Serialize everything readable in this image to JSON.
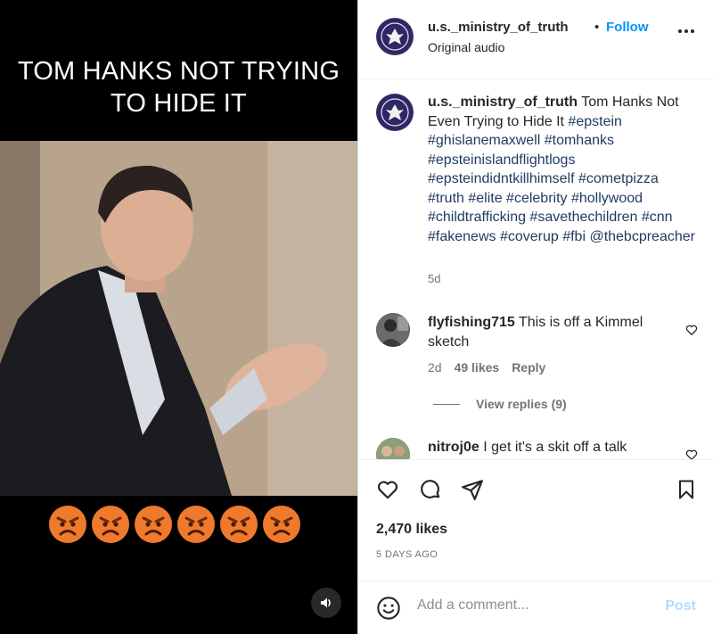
{
  "video": {
    "overlay_caption": "TOM HANKS NOT TRYING TO HIDE IT",
    "reaction_emoji_count": 6,
    "reaction_emoji_icon": "angry-face-icon",
    "sound_icon": "speaker-icon"
  },
  "header": {
    "username": "u.s._ministry_of_truth",
    "separator": "•",
    "follow_label": "Follow",
    "audio_label": "Original audio",
    "more_icon": "more-horizontal-icon"
  },
  "caption": {
    "username": "u.s._ministry_of_truth",
    "text": "Tom Hanks Not Even Trying to Hide It",
    "tags": "#epstein #ghislanemaxwell #tomhanks #epsteinislandflightlogs #epsteindidntkillhimself #cometpizza #truth #elite #celebrity #hollywood #childtrafficking #savethechildren #cnn #fakenews #coverup #fbi @thebcpreacher",
    "age": "5d"
  },
  "comments": [
    {
      "username": "flyfishing715",
      "text": "This is off a Kimmel sketch",
      "age": "2d",
      "likes": "49 likes",
      "reply_label": "Reply",
      "view_replies": "View replies (9)"
    },
    {
      "username": "nitroj0e",
      "text": "I get it's a skit off a talk"
    }
  ],
  "actions": {
    "like_icon": "heart-icon",
    "comment_icon": "comment-icon",
    "share_icon": "share-icon",
    "save_icon": "bookmark-icon",
    "likes_count": "2,470 likes",
    "date": "5 DAYS AGO"
  },
  "add_comment": {
    "placeholder": "Add a comment...",
    "post_label": "Post"
  },
  "colors": {
    "follow_blue": "#0095f6",
    "hashtag_blue": "#1f3a5f",
    "post_disabled": "#b3dbff",
    "muted_text": "#737373"
  }
}
